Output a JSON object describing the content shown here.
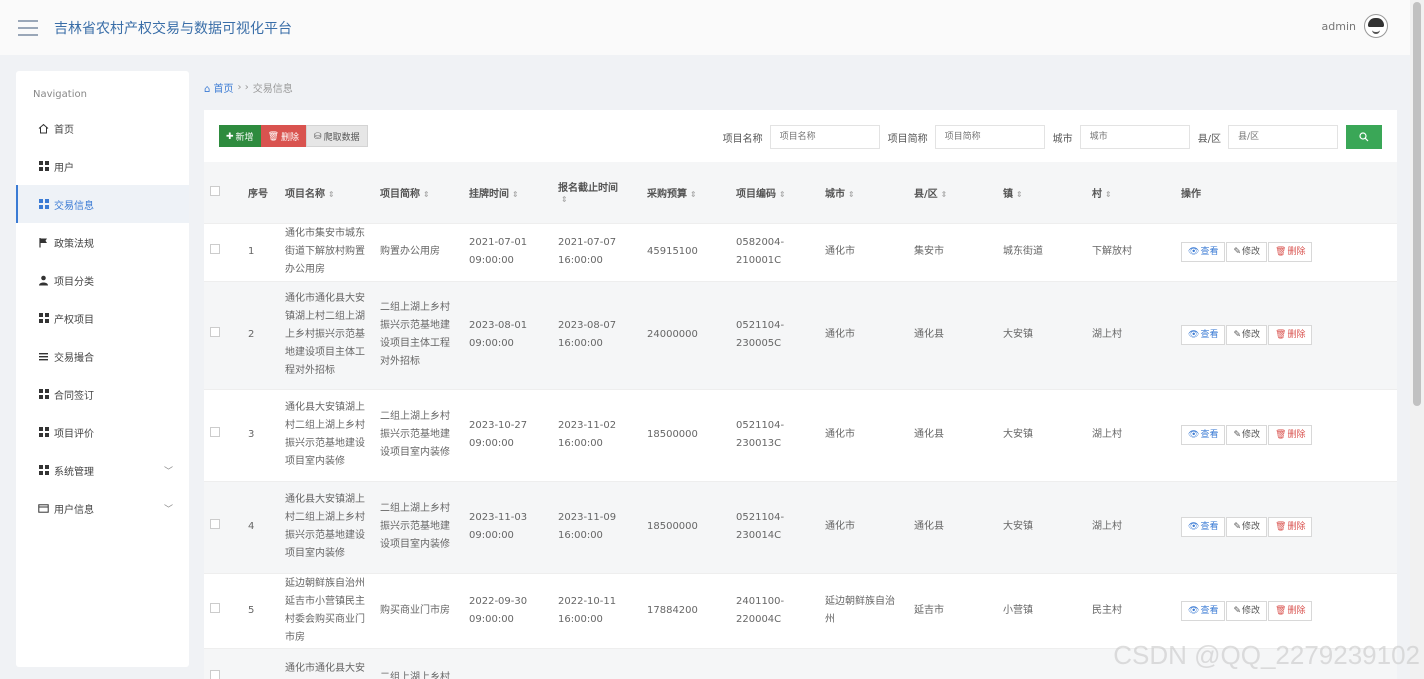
{
  "header": {
    "title": "吉林省农村产权交易与数据可视化平台",
    "user": "admin"
  },
  "sidebar": {
    "title": "Navigation",
    "items": [
      {
        "label": "首页",
        "icon": "home-icon"
      },
      {
        "label": "用户",
        "icon": "grid-icon"
      },
      {
        "label": "交易信息",
        "icon": "grid-icon"
      },
      {
        "label": "政策法规",
        "icon": "flag-icon"
      },
      {
        "label": "项目分类",
        "icon": "person-icon"
      },
      {
        "label": "产权项目",
        "icon": "grid-icon"
      },
      {
        "label": "交易撮合",
        "icon": "list-icon"
      },
      {
        "label": "合同签订",
        "icon": "grid-icon"
      },
      {
        "label": "项目评价",
        "icon": "grid-icon"
      },
      {
        "label": "系统管理",
        "icon": "grid-icon"
      },
      {
        "label": "用户信息",
        "icon": "card-icon"
      }
    ]
  },
  "breadcrumb": {
    "home": "首页",
    "sep": "› ›",
    "current": "交易信息"
  },
  "toolbar": {
    "add": "新增",
    "delete": "删除",
    "crawl": "爬取数据"
  },
  "filters": [
    {
      "label": "项目名称",
      "placeholder": "项目名称"
    },
    {
      "label": "项目简称",
      "placeholder": "项目简称"
    },
    {
      "label": "城市",
      "placeholder": "城市"
    },
    {
      "label": "县/区",
      "placeholder": "县/区"
    }
  ],
  "table": {
    "headers": [
      "序号",
      "项目名称",
      "项目简称",
      "挂牌时间",
      "报名截止时间",
      "采购预算",
      "项目编码",
      "城市",
      "县/区",
      "镇",
      "村",
      "操作"
    ],
    "actions": {
      "view": "查看",
      "edit": "修改",
      "delete": "删除"
    },
    "rows": [
      {
        "no": "1",
        "name": "通化市集安市城东街道下解放村购置办公用房",
        "short": "购置办公用房",
        "list_time": "2021-07-01 09:00:00",
        "deadline": "2021-07-07 16:00:00",
        "budget": "45915100",
        "code": "0582004-210001C",
        "city": "通化市",
        "county": "集安市",
        "town": "城东街道",
        "village": "下解放村"
      },
      {
        "no": "2",
        "name": "通化市通化县大安镇湖上村二组上湖上乡村振兴示范基地建设项目主体工程对外招标",
        "short": "二组上湖上乡村振兴示范基地建设项目主体工程对外招标",
        "list_time": "2023-08-01 09:00:00",
        "deadline": "2023-08-07 16:00:00",
        "budget": "24000000",
        "code": "0521104-230005C",
        "city": "通化市",
        "county": "通化县",
        "town": "大安镇",
        "village": "湖上村"
      },
      {
        "no": "3",
        "name": "通化县大安镇湖上村二组上湖上乡村振兴示范基地建设项目室内装修",
        "short": "二组上湖上乡村振兴示范基地建设项目室内装修",
        "list_time": "2023-10-27 09:00:00",
        "deadline": "2023-11-02 16:00:00",
        "budget": "18500000",
        "code": "0521104-230013C",
        "city": "通化市",
        "county": "通化县",
        "town": "大安镇",
        "village": "湖上村"
      },
      {
        "no": "4",
        "name": "通化县大安镇湖上村二组上湖上乡村振兴示范基地建设项目室内装修",
        "short": "二组上湖上乡村振兴示范基地建设项目室内装修",
        "list_time": "2023-11-03 09:00:00",
        "deadline": "2023-11-09 16:00:00",
        "budget": "18500000",
        "code": "0521104-230014C",
        "city": "通化市",
        "county": "通化县",
        "town": "大安镇",
        "village": "湖上村"
      },
      {
        "no": "5",
        "name": "延边朝鲜族自治州延吉市小营镇民主村委会购买商业门市房",
        "short": "购买商业门市房",
        "list_time": "2022-09-30 09:00:00",
        "deadline": "2022-10-11 16:00:00",
        "budget": "17884200",
        "code": "2401100-220004C",
        "city": "延边朝鲜族自治州",
        "county": "延吉市",
        "town": "小营镇",
        "village": "民主村"
      },
      {
        "no": "",
        "name": "通化市通化县大安镇湖上村二组",
        "short": "二组上湖上乡村",
        "list_time": "",
        "deadline": "",
        "budget": "",
        "code": "",
        "city": "",
        "county": "",
        "town": "",
        "village": ""
      }
    ]
  },
  "watermark": "CSDN @QQ_2279239102"
}
